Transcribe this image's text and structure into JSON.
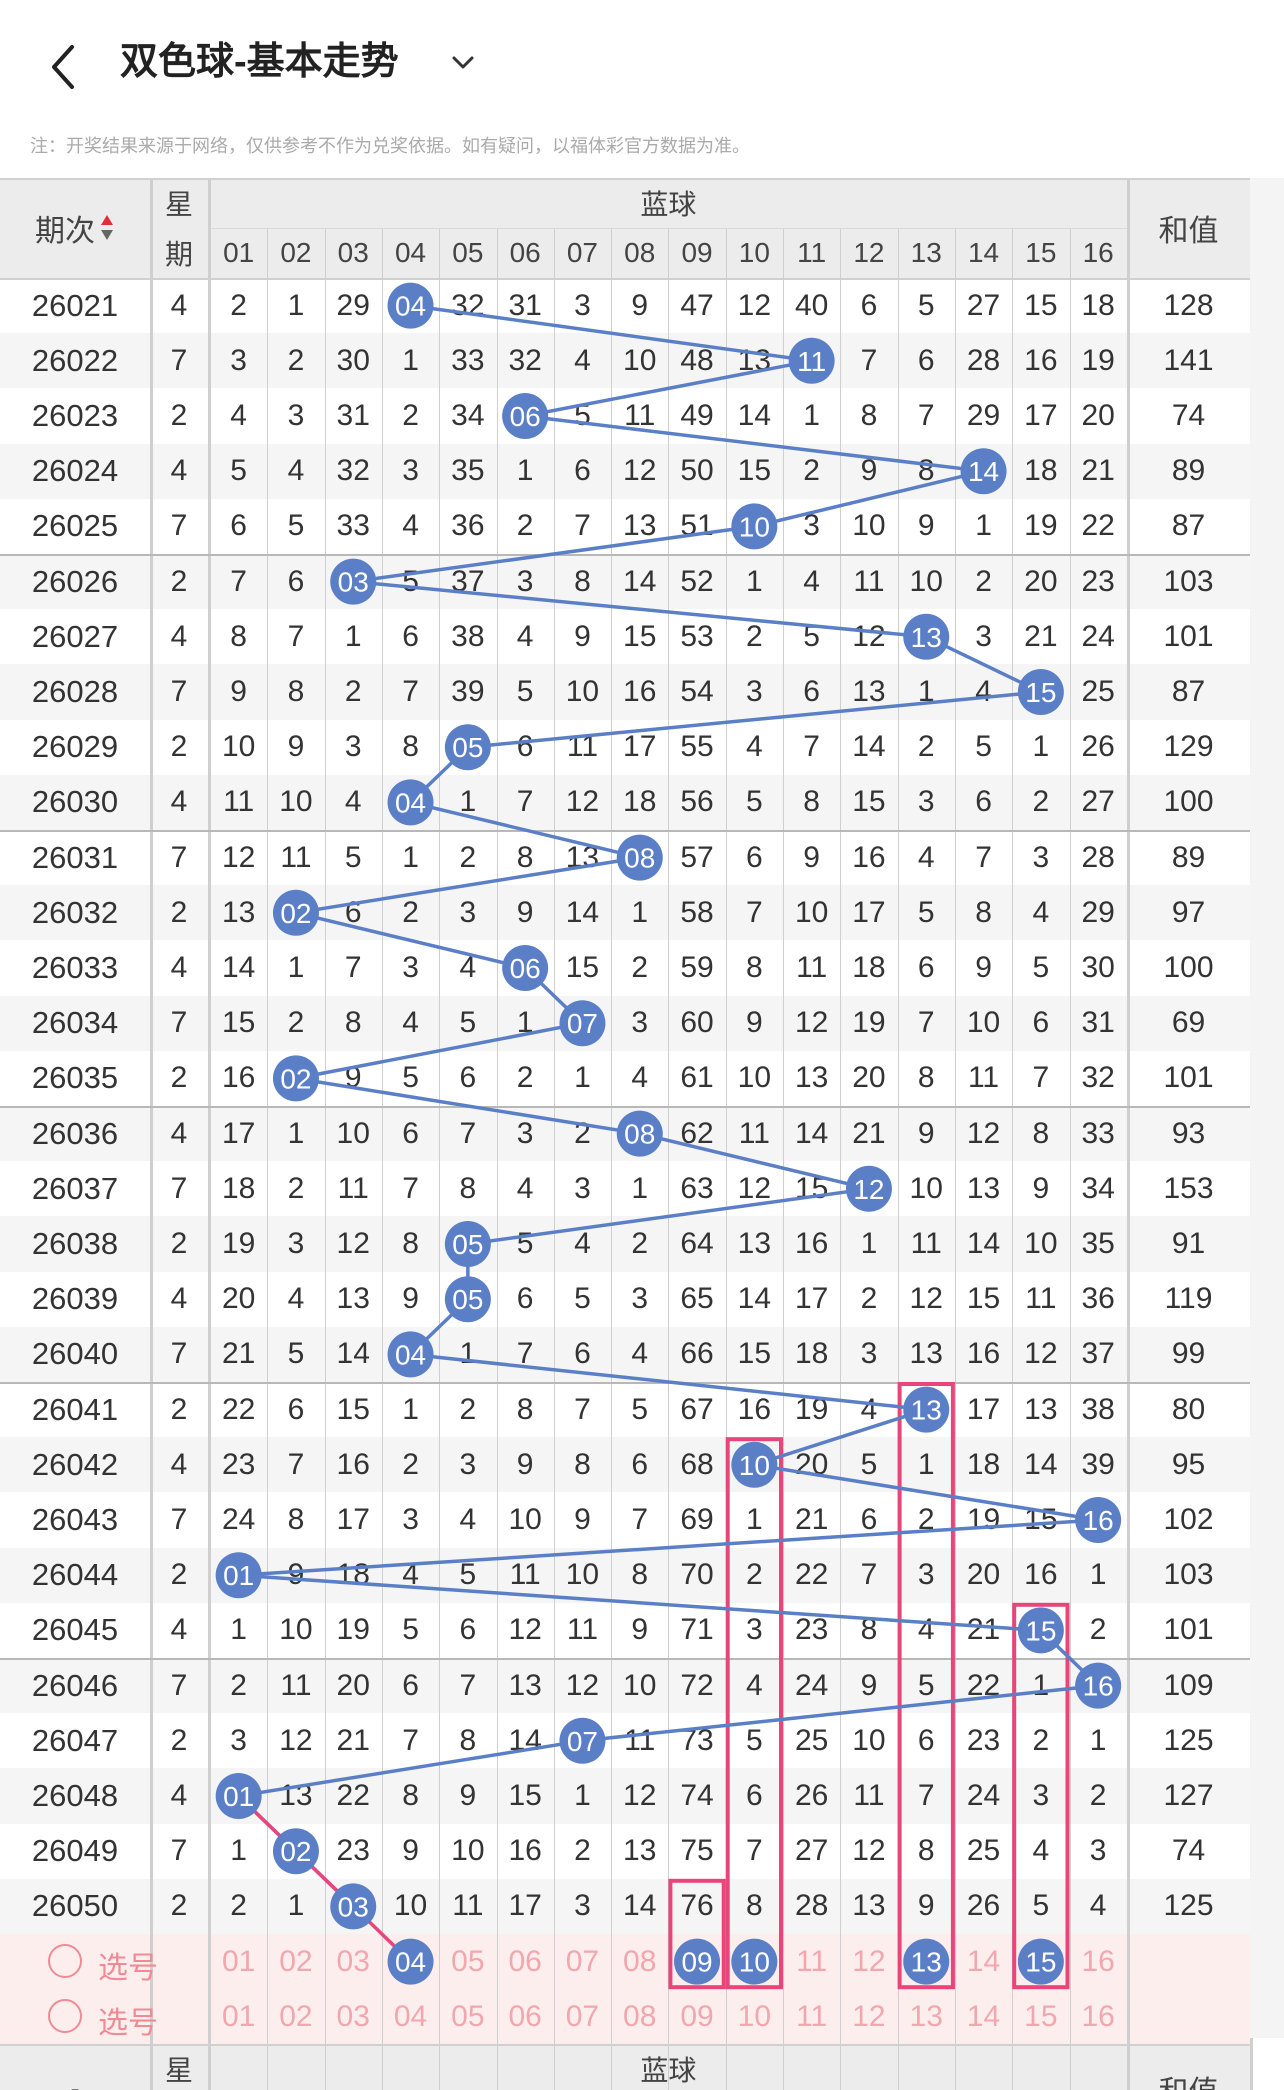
{
  "header": {
    "title": "双色球-基本走势",
    "notice": "注：开奖结果来源于网络，仅供参考不作为兑奖依据。如有疑问，以福体彩官方数据为准。",
    "back_icon": "chevron-left-icon",
    "dropdown_icon": "chevron-down-icon"
  },
  "table": {
    "col_issue": "期次",
    "col_week": "星期",
    "col_blue": "蓝球",
    "col_sum": "和值",
    "blue_numbers": [
      "01",
      "02",
      "03",
      "04",
      "05",
      "06",
      "07",
      "08",
      "09",
      "10",
      "11",
      "12",
      "13",
      "14",
      "15",
      "16"
    ],
    "rows": [
      {
        "issue": "26021",
        "week": "4",
        "blue": 4,
        "vals": [
          "2",
          "1",
          "29",
          "04",
          "32",
          "31",
          "3",
          "9",
          "47",
          "12",
          "40",
          "6",
          "5",
          "27",
          "15",
          "18"
        ],
        "sum": "128"
      },
      {
        "issue": "26022",
        "week": "7",
        "blue": 11,
        "vals": [
          "3",
          "2",
          "30",
          "1",
          "33",
          "32",
          "4",
          "10",
          "48",
          "13",
          "11",
          "7",
          "6",
          "28",
          "16",
          "19"
        ],
        "sum": "141"
      },
      {
        "issue": "26023",
        "week": "2",
        "blue": 6,
        "vals": [
          "4",
          "3",
          "31",
          "2",
          "34",
          "06",
          "5",
          "11",
          "49",
          "14",
          "1",
          "8",
          "7",
          "29",
          "17",
          "20"
        ],
        "sum": "74"
      },
      {
        "issue": "26024",
        "week": "4",
        "blue": 14,
        "vals": [
          "5",
          "4",
          "32",
          "3",
          "35",
          "1",
          "6",
          "12",
          "50",
          "15",
          "2",
          "9",
          "8",
          "14",
          "18",
          "21"
        ],
        "sum": "89"
      },
      {
        "issue": "26025",
        "week": "7",
        "blue": 10,
        "vals": [
          "6",
          "5",
          "33",
          "4",
          "36",
          "2",
          "7",
          "13",
          "51",
          "10",
          "3",
          "10",
          "9",
          "1",
          "19",
          "22"
        ],
        "sum": "87"
      },
      {
        "issue": "26026",
        "week": "2",
        "blue": 3,
        "vals": [
          "7",
          "6",
          "03",
          "5",
          "37",
          "3",
          "8",
          "14",
          "52",
          "1",
          "4",
          "11",
          "10",
          "2",
          "20",
          "23"
        ],
        "sum": "103"
      },
      {
        "issue": "26027",
        "week": "4",
        "blue": 13,
        "vals": [
          "8",
          "7",
          "1",
          "6",
          "38",
          "4",
          "9",
          "15",
          "53",
          "2",
          "5",
          "12",
          "13",
          "3",
          "21",
          "24"
        ],
        "sum": "101"
      },
      {
        "issue": "26028",
        "week": "7",
        "blue": 15,
        "vals": [
          "9",
          "8",
          "2",
          "7",
          "39",
          "5",
          "10",
          "16",
          "54",
          "3",
          "6",
          "13",
          "1",
          "4",
          "15",
          "25"
        ],
        "sum": "87"
      },
      {
        "issue": "26029",
        "week": "2",
        "blue": 5,
        "vals": [
          "10",
          "9",
          "3",
          "8",
          "05",
          "6",
          "11",
          "17",
          "55",
          "4",
          "7",
          "14",
          "2",
          "5",
          "1",
          "26"
        ],
        "sum": "129"
      },
      {
        "issue": "26030",
        "week": "4",
        "blue": 4,
        "vals": [
          "11",
          "10",
          "4",
          "04",
          "1",
          "7",
          "12",
          "18",
          "56",
          "5",
          "8",
          "15",
          "3",
          "6",
          "2",
          "27"
        ],
        "sum": "100"
      },
      {
        "issue": "26031",
        "week": "7",
        "blue": 8,
        "vals": [
          "12",
          "11",
          "5",
          "1",
          "2",
          "8",
          "13",
          "08",
          "57",
          "6",
          "9",
          "16",
          "4",
          "7",
          "3",
          "28"
        ],
        "sum": "89"
      },
      {
        "issue": "26032",
        "week": "2",
        "blue": 2,
        "vals": [
          "13",
          "02",
          "6",
          "2",
          "3",
          "9",
          "14",
          "1",
          "58",
          "7",
          "10",
          "17",
          "5",
          "8",
          "4",
          "29"
        ],
        "sum": "97"
      },
      {
        "issue": "26033",
        "week": "4",
        "blue": 6,
        "vals": [
          "14",
          "1",
          "7",
          "3",
          "4",
          "06",
          "15",
          "2",
          "59",
          "8",
          "11",
          "18",
          "6",
          "9",
          "5",
          "30"
        ],
        "sum": "100"
      },
      {
        "issue": "26034",
        "week": "7",
        "blue": 7,
        "vals": [
          "15",
          "2",
          "8",
          "4",
          "5",
          "1",
          "07",
          "3",
          "60",
          "9",
          "12",
          "19",
          "7",
          "10",
          "6",
          "31"
        ],
        "sum": "69"
      },
      {
        "issue": "26035",
        "week": "2",
        "blue": 2,
        "vals": [
          "16",
          "02",
          "9",
          "5",
          "6",
          "2",
          "1",
          "4",
          "61",
          "10",
          "13",
          "20",
          "8",
          "11",
          "7",
          "32"
        ],
        "sum": "101"
      },
      {
        "issue": "26036",
        "week": "4",
        "blue": 8,
        "vals": [
          "17",
          "1",
          "10",
          "6",
          "7",
          "3",
          "2",
          "08",
          "62",
          "11",
          "14",
          "21",
          "9",
          "12",
          "8",
          "33"
        ],
        "sum": "93"
      },
      {
        "issue": "26037",
        "week": "7",
        "blue": 12,
        "vals": [
          "18",
          "2",
          "11",
          "7",
          "8",
          "4",
          "3",
          "1",
          "63",
          "12",
          "15",
          "12",
          "10",
          "13",
          "9",
          "34"
        ],
        "sum": "153"
      },
      {
        "issue": "26038",
        "week": "2",
        "blue": 5,
        "vals": [
          "19",
          "3",
          "12",
          "8",
          "05",
          "5",
          "4",
          "2",
          "64",
          "13",
          "16",
          "1",
          "11",
          "14",
          "10",
          "35"
        ],
        "sum": "91"
      },
      {
        "issue": "26039",
        "week": "4",
        "blue": 5,
        "vals": [
          "20",
          "4",
          "13",
          "9",
          "05",
          "6",
          "5",
          "3",
          "65",
          "14",
          "17",
          "2",
          "12",
          "15",
          "11",
          "36"
        ],
        "sum": "119"
      },
      {
        "issue": "26040",
        "week": "7",
        "blue": 4,
        "vals": [
          "21",
          "5",
          "14",
          "04",
          "1",
          "7",
          "6",
          "4",
          "66",
          "15",
          "18",
          "3",
          "13",
          "16",
          "12",
          "37"
        ],
        "sum": "99"
      },
      {
        "issue": "26041",
        "week": "2",
        "blue": 13,
        "vals": [
          "22",
          "6",
          "15",
          "1",
          "2",
          "8",
          "7",
          "5",
          "67",
          "16",
          "19",
          "4",
          "13",
          "17",
          "13",
          "38"
        ],
        "sum": "80"
      },
      {
        "issue": "26042",
        "week": "4",
        "blue": 10,
        "vals": [
          "23",
          "7",
          "16",
          "2",
          "3",
          "9",
          "8",
          "6",
          "68",
          "10",
          "20",
          "5",
          "1",
          "18",
          "14",
          "39"
        ],
        "sum": "95"
      },
      {
        "issue": "26043",
        "week": "7",
        "blue": 16,
        "vals": [
          "24",
          "8",
          "17",
          "3",
          "4",
          "10",
          "9",
          "7",
          "69",
          "1",
          "21",
          "6",
          "2",
          "19",
          "15",
          "16"
        ],
        "sum": "102"
      },
      {
        "issue": "26044",
        "week": "2",
        "blue": 1,
        "vals": [
          "01",
          "9",
          "18",
          "4",
          "5",
          "11",
          "10",
          "8",
          "70",
          "2",
          "22",
          "7",
          "3",
          "20",
          "16",
          "1"
        ],
        "sum": "103"
      },
      {
        "issue": "26045",
        "week": "4",
        "blue": 15,
        "vals": [
          "1",
          "10",
          "19",
          "5",
          "6",
          "12",
          "11",
          "9",
          "71",
          "3",
          "23",
          "8",
          "4",
          "21",
          "15",
          "2"
        ],
        "sum": "101"
      },
      {
        "issue": "26046",
        "week": "7",
        "blue": 16,
        "vals": [
          "2",
          "11",
          "20",
          "6",
          "7",
          "13",
          "12",
          "10",
          "72",
          "4",
          "24",
          "9",
          "5",
          "22",
          "1",
          "16"
        ],
        "sum": "109"
      },
      {
        "issue": "26047",
        "week": "2",
        "blue": 7,
        "vals": [
          "3",
          "12",
          "21",
          "7",
          "8",
          "14",
          "07",
          "11",
          "73",
          "5",
          "25",
          "10",
          "6",
          "23",
          "2",
          "1"
        ],
        "sum": "125"
      },
      {
        "issue": "26048",
        "week": "4",
        "blue": 1,
        "vals": [
          "01",
          "13",
          "22",
          "8",
          "9",
          "15",
          "1",
          "12",
          "74",
          "6",
          "26",
          "11",
          "7",
          "24",
          "3",
          "2"
        ],
        "sum": "127"
      },
      {
        "issue": "26049",
        "week": "7",
        "blue": 2,
        "vals": [
          "1",
          "02",
          "23",
          "9",
          "10",
          "16",
          "2",
          "13",
          "75",
          "7",
          "27",
          "12",
          "8",
          "25",
          "4",
          "3"
        ],
        "sum": "74"
      },
      {
        "issue": "26050",
        "week": "2",
        "blue": 3,
        "vals": [
          "2",
          "1",
          "03",
          "10",
          "11",
          "17",
          "3",
          "14",
          "76",
          "8",
          "28",
          "13",
          "9",
          "26",
          "5",
          "4"
        ],
        "sum": "125"
      }
    ],
    "select_rows": [
      {
        "label": "选号",
        "selected": [
          4,
          9,
          10,
          13,
          15
        ]
      },
      {
        "label": "选号",
        "selected": []
      }
    ],
    "highlight_columns": [
      9,
      10,
      13,
      15
    ],
    "blue_color": "#5b7fc7",
    "pink_color": "#e8457a"
  }
}
